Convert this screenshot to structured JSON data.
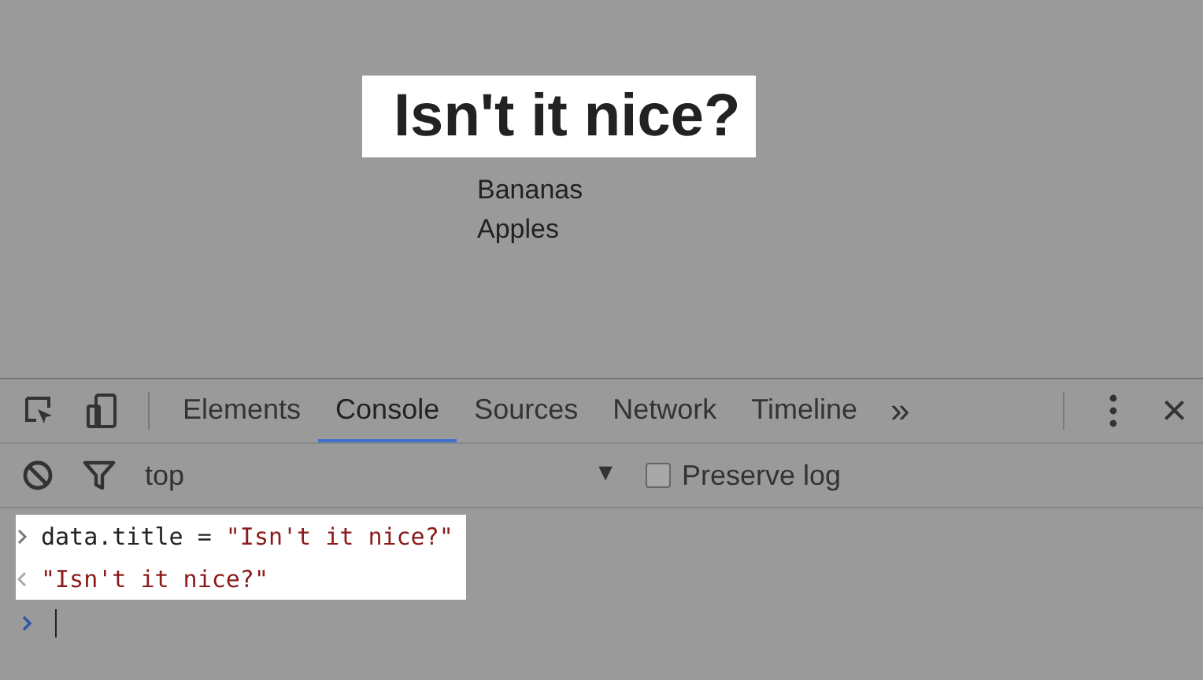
{
  "page": {
    "title": "Isn't it nice?",
    "title_highlighted": true,
    "items": [
      "Bananas",
      "Apples"
    ]
  },
  "devtools": {
    "tabs": [
      {
        "label": "Elements",
        "selected": false
      },
      {
        "label": "Console",
        "selected": true
      },
      {
        "label": "Sources",
        "selected": false
      },
      {
        "label": "Network",
        "selected": false
      },
      {
        "label": "Timeline",
        "selected": false
      }
    ],
    "more": "»",
    "close": "×",
    "context": "top",
    "context_caret": "▼",
    "preserve_log": {
      "label": "Preserve log",
      "checked": false
    },
    "entries_highlighted": true,
    "entries": [
      {
        "kind": "input",
        "code": "data.title = ",
        "string": "\"Isn't it nice?\""
      },
      {
        "kind": "output",
        "string": "\"Isn't it nice?\""
      }
    ]
  }
}
